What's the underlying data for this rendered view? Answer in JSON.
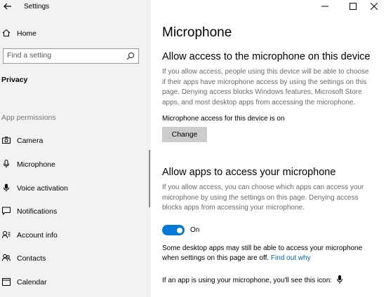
{
  "window": {
    "app_title": "Settings",
    "controls": [
      "minimize-icon",
      "maximize-icon",
      "close-icon"
    ]
  },
  "sidebar": {
    "home_label": "Home",
    "search_placeholder": "Find a setting",
    "category": "Privacy",
    "section_heading": "App permissions",
    "items": [
      {
        "label": "Camera",
        "icon": "camera-icon"
      },
      {
        "label": "Microphone",
        "icon": "microphone-icon"
      },
      {
        "label": "Voice activation",
        "icon": "voice-activation-icon"
      },
      {
        "label": "Notifications",
        "icon": "notifications-icon"
      },
      {
        "label": "Account info",
        "icon": "account-info-icon"
      },
      {
        "label": "Contacts",
        "icon": "contacts-icon"
      },
      {
        "label": "Calendar",
        "icon": "calendar-icon"
      }
    ]
  },
  "main": {
    "title": "Microphone",
    "device_section": {
      "heading": "Allow access to the microphone on this device",
      "description": "If you allow access, people using this device will be able to choose if their apps have microphone access by using the settings on this page. Denying access blocks Windows features, Microsoft Store apps, and most desktop apps from accessing the microphone.",
      "status": "Microphone access for this device is on",
      "change_button": "Change"
    },
    "apps_section": {
      "heading": "Allow apps to access your microphone",
      "description": "If you allow access, you can choose which apps can access your microphone by using the settings on this page. Denying access blocks apps from accessing your microphone.",
      "toggle_state": "On",
      "desktop_note": "Some desktop apps may still be able to access your microphone when settings on this page are off.",
      "find_out_link": "Find out why",
      "icon_note": "If an app is using your microphone, you'll see this icon:"
    }
  },
  "colors": {
    "accent": "#0078d7",
    "link": "#0063b1",
    "sidebar_bg": "#f2f2f2",
    "button_bg": "#cccccc"
  }
}
